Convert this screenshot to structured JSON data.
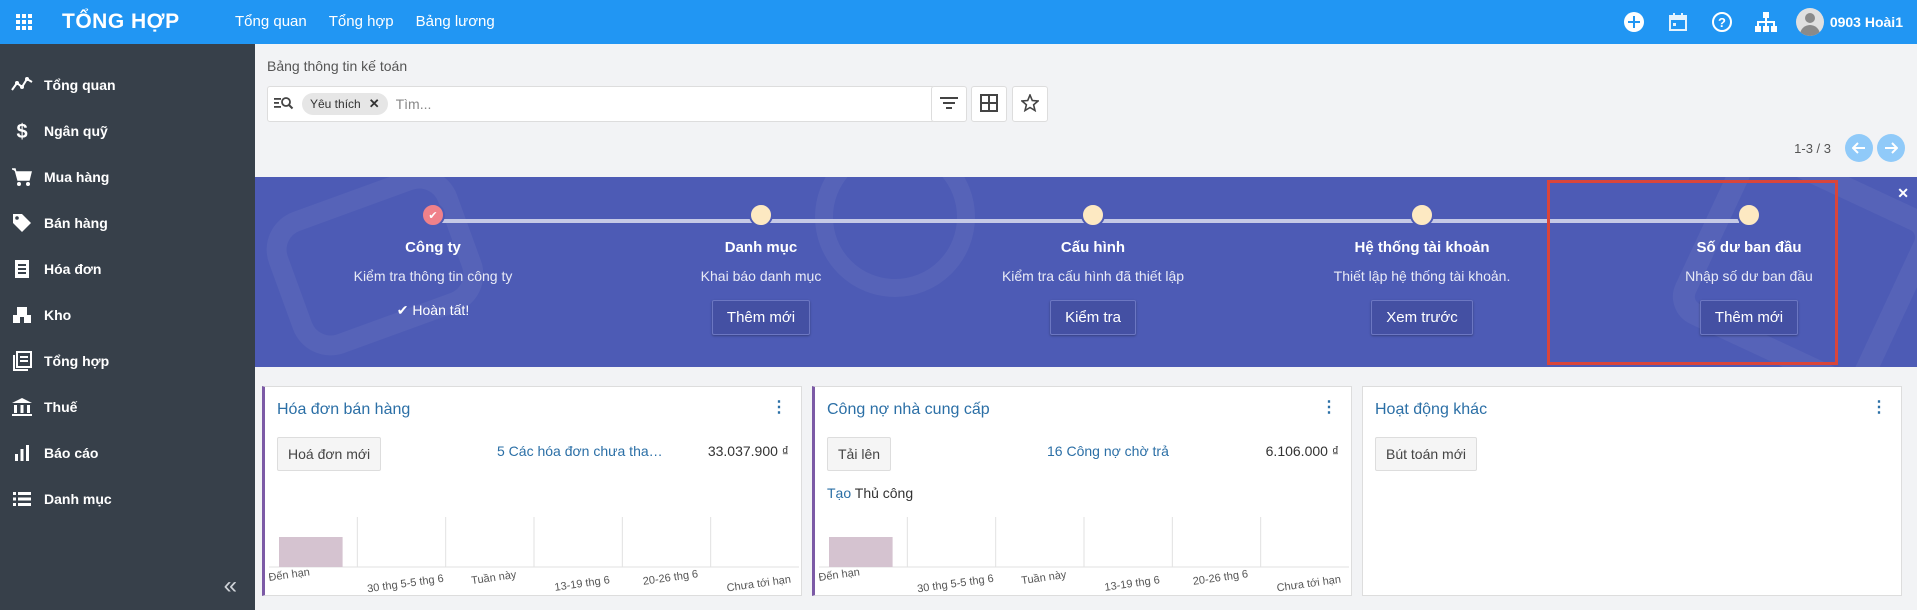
{
  "app": {
    "brand": "TỔNG HỢP",
    "nav": [
      "Tổng quan",
      "Tổng hợp",
      "Bảng lương"
    ],
    "user": "0903 Hoài1"
  },
  "sidebar": {
    "items": [
      {
        "label": "Tổng quan",
        "icon": "activity-icon"
      },
      {
        "label": "Ngân quỹ",
        "icon": "dollar-icon"
      },
      {
        "label": "Mua hàng",
        "icon": "cart-icon"
      },
      {
        "label": "Bán hàng",
        "icon": "tag-icon"
      },
      {
        "label": "Hóa đơn",
        "icon": "receipt-icon"
      },
      {
        "label": "Kho",
        "icon": "warehouse-icon"
      },
      {
        "label": "Tổng hợp",
        "icon": "ledger-icon"
      },
      {
        "label": "Thuế",
        "icon": "bank-icon"
      },
      {
        "label": "Báo cáo",
        "icon": "bar-chart-icon"
      },
      {
        "label": "Danh mục",
        "icon": "list-icon"
      }
    ],
    "collapse": "«"
  },
  "breadcrumb": "Bảng thông tin kế toán",
  "search": {
    "facet": "Yêu thích",
    "placeholder": "Tìm..."
  },
  "pager": {
    "text": "1-3 / 3"
  },
  "onboarding": {
    "steps": [
      {
        "title": "Công ty",
        "desc": "Kiểm tra thông tin công ty",
        "done_label": "✔ Hoàn tất!",
        "done": true
      },
      {
        "title": "Danh mục",
        "desc": "Khai báo danh mục",
        "button": "Thêm mới"
      },
      {
        "title": "Cấu hình",
        "desc": "Kiểm tra cấu hình đã thiết lập",
        "button": "Kiểm tra"
      },
      {
        "title": "Hệ thống tài khoản",
        "desc": "Thiết lập hệ thống tài khoản.",
        "button": "Xem trước"
      },
      {
        "title": "Số dư ban đầu",
        "desc": "Nhập số dư ban đầu",
        "button": "Thêm mới"
      }
    ],
    "colors": {
      "background": "#4d5bb5",
      "done_dot": "#f0818a",
      "pending_dot": "#fde9c2",
      "highlight": "#d9453a"
    }
  },
  "cards": [
    {
      "title": "Hóa đơn bán hàng",
      "button": "Hoá đơn mới",
      "link": "5 Các hóa đơn chưa than...",
      "amount": "33.037.900 ₫"
    },
    {
      "title": "Công nợ nhà cung cấp",
      "button": "Tải lên",
      "link": "16 Công nợ chờ trả",
      "amount": "6.106.000 ₫",
      "extra_link": "Tạo",
      "extra_text": " Thủ công"
    },
    {
      "title": "Hoạt động khác",
      "button": "Bút toán mới"
    }
  ],
  "chart_data": [
    {
      "type": "bar",
      "categories": [
        "Đến hạn",
        "30 thg 5-5 thg 6",
        "Tuần này",
        "13-19 thg 6",
        "20-26 thg 6",
        "Chưa tới hạn"
      ],
      "values": [
        1,
        0,
        0,
        0,
        0,
        0
      ],
      "color": "#d5c3d0"
    },
    {
      "type": "bar",
      "categories": [
        "Đến hạn",
        "30 thg 5-5 thg 6",
        "Tuần này",
        "13-19 thg 6",
        "20-26 thg 6",
        "Chưa tới hạn"
      ],
      "values": [
        1,
        0,
        0,
        0,
        0,
        0
      ],
      "color": "#d5c3d0"
    }
  ]
}
